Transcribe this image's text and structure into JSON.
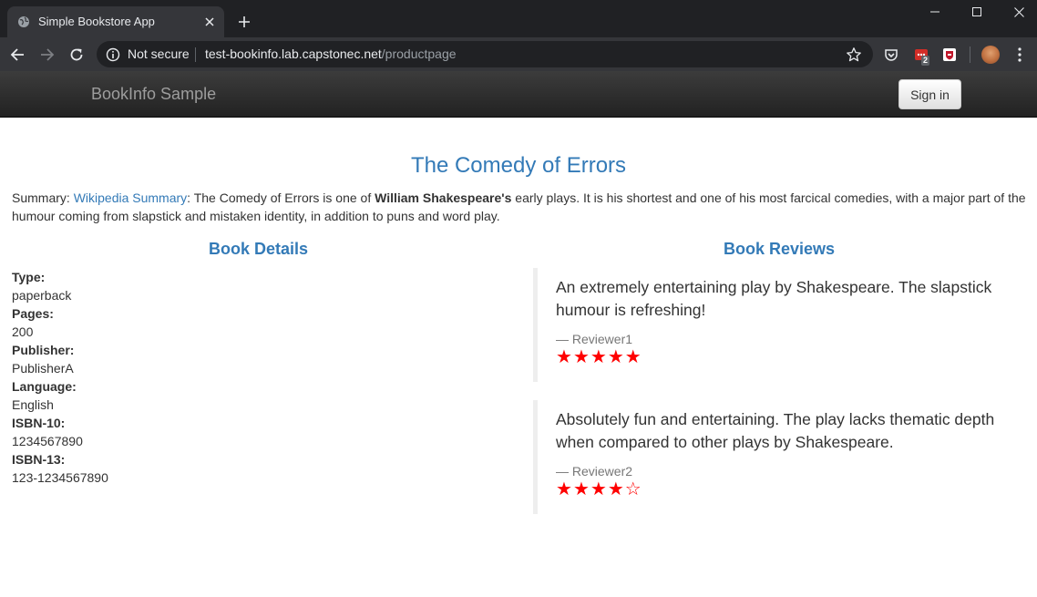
{
  "browser": {
    "tab_title": "Simple Bookstore App",
    "security_label": "Not secure",
    "url_host": "test-bookinfo.lab.capstonec.net",
    "url_path": "/productpage",
    "extension_badge": "2"
  },
  "navbar": {
    "brand": "BookInfo Sample",
    "signin_label": "Sign in"
  },
  "book": {
    "title": "The Comedy of Errors",
    "summary_label": "Summary: ",
    "summary_link": "Wikipedia Summary",
    "summary_text_1": ": The Comedy of Errors is one of ",
    "summary_bold": "William Shakespeare's",
    "summary_text_2": " early plays. It is his shortest and one of his most farcical comedies, with a major part of the humour coming from slapstick and mistaken identity, in addition to puns and word play."
  },
  "details": {
    "heading": "Book Details",
    "fields": [
      {
        "label": "Type:",
        "value": "paperback"
      },
      {
        "label": "Pages:",
        "value": "200"
      },
      {
        "label": "Publisher:",
        "value": "PublisherA"
      },
      {
        "label": "Language:",
        "value": "English"
      },
      {
        "label": "ISBN-10:",
        "value": "1234567890"
      },
      {
        "label": "ISBN-13:",
        "value": "123-1234567890"
      }
    ]
  },
  "reviews": {
    "heading": "Book Reviews",
    "items": [
      {
        "text": "An extremely entertaining play by Shakespeare. The slapstick humour is refreshing!",
        "reviewer": "— Reviewer1",
        "rating": 5,
        "max_rating": 5,
        "star_color": "#ff0000"
      },
      {
        "text": "Absolutely fun and entertaining. The play lacks thematic depth when compared to other plays by Shakespeare.",
        "reviewer": "— Reviewer2",
        "rating": 4,
        "max_rating": 5,
        "star_color": "#ff0000"
      }
    ]
  },
  "colors": {
    "link": "#337ab7",
    "navbar_bg": "#222222",
    "chrome_bg": "#202124"
  }
}
